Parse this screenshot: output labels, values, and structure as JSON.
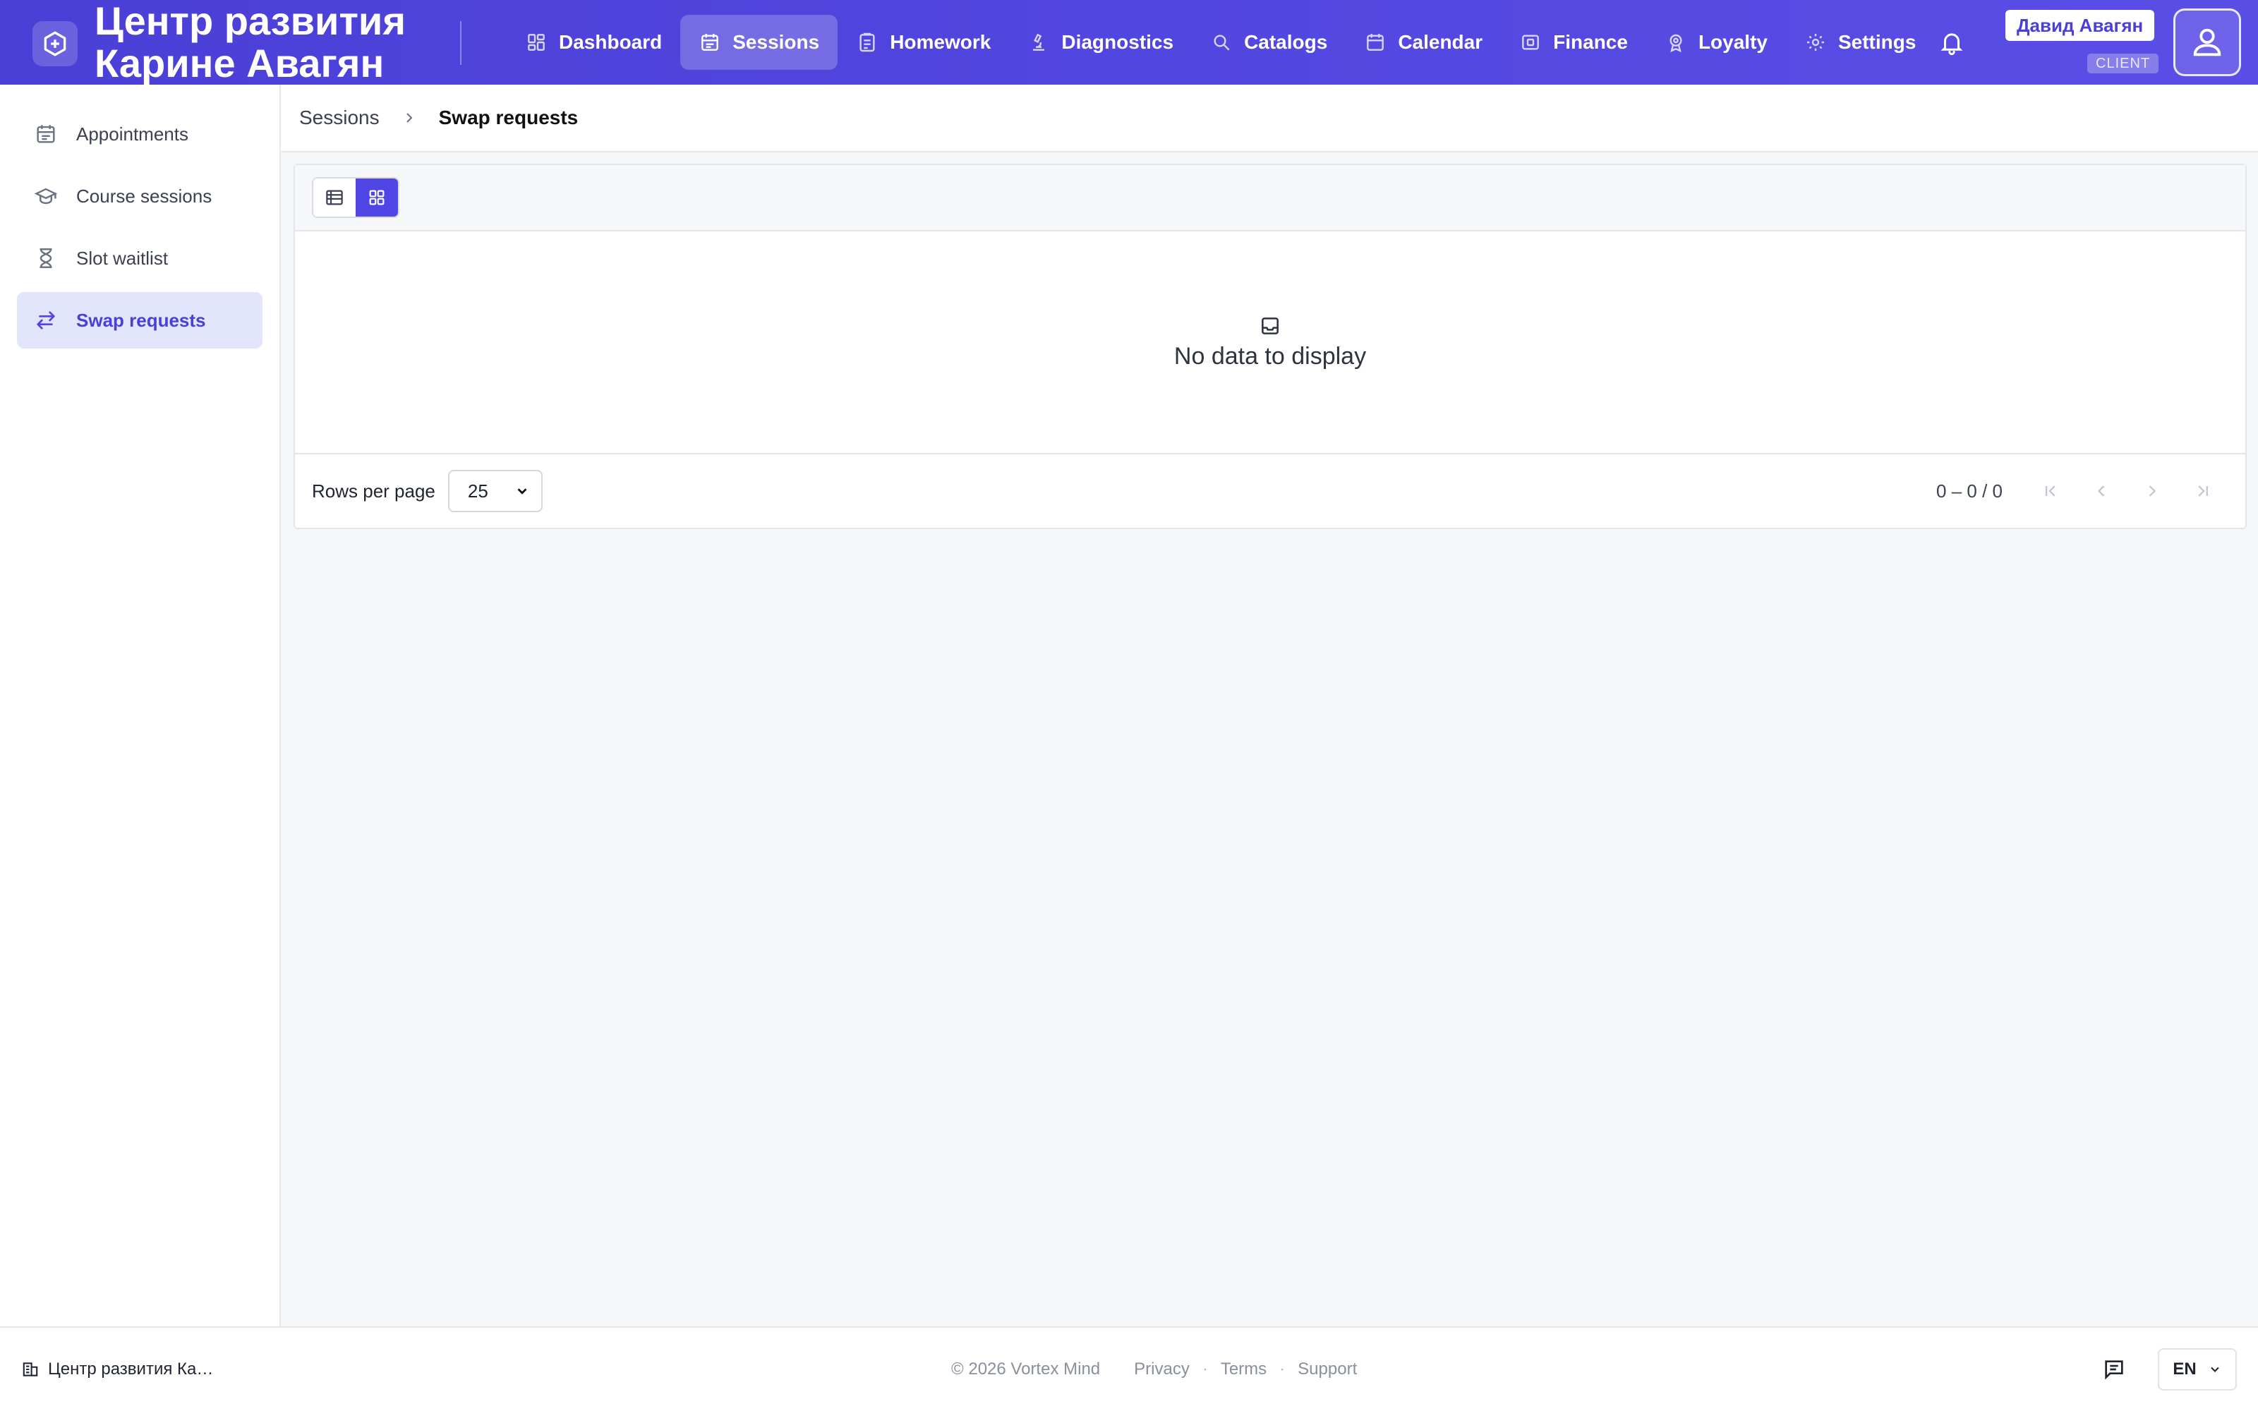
{
  "header": {
    "brand_title": "Центр развития\nКарине Авагян",
    "nav": [
      {
        "label": "Dashboard",
        "icon": "dashboard-icon"
      },
      {
        "label": "Sessions",
        "icon": "calendar-icon",
        "active": true
      },
      {
        "label": "Homework",
        "icon": "clipboard-icon"
      },
      {
        "label": "Diagnostics",
        "icon": "microscope-icon"
      },
      {
        "label": "Catalogs",
        "icon": "search-icon"
      },
      {
        "label": "Calendar",
        "icon": "calendar-icon"
      },
      {
        "label": "Finance",
        "icon": "wallet-icon"
      },
      {
        "label": "Loyalty",
        "icon": "award-icon"
      },
      {
        "label": "Settings",
        "icon": "gear-icon"
      }
    ],
    "user_name": "Давид Авагян",
    "role": "CLIENT",
    "accent": "#4f46e5"
  },
  "sidebar": {
    "items": [
      {
        "label": "Appointments",
        "icon": "calendar-icon"
      },
      {
        "label": "Course sessions",
        "icon": "graduation-cap-icon"
      },
      {
        "label": "Slot waitlist",
        "icon": "hourglass-icon"
      },
      {
        "label": "Swap requests",
        "icon": "swap-arrows-icon",
        "active": true
      }
    ]
  },
  "breadcrumb": {
    "parent": "Sessions",
    "current": "Swap requests"
  },
  "table": {
    "view_modes": [
      "table-view",
      "grid-view"
    ],
    "active_view": "grid-view",
    "empty_text": "No data to display",
    "rows_per_page_label": "Rows per page",
    "rows_per_page": "25",
    "range": "0 – 0 / 0"
  },
  "footer": {
    "org_name": "Центр развития Ка…",
    "copyright": "© 2026 Vortex Mind",
    "links": [
      "Privacy",
      "Terms",
      "Support"
    ],
    "language": "EN"
  }
}
